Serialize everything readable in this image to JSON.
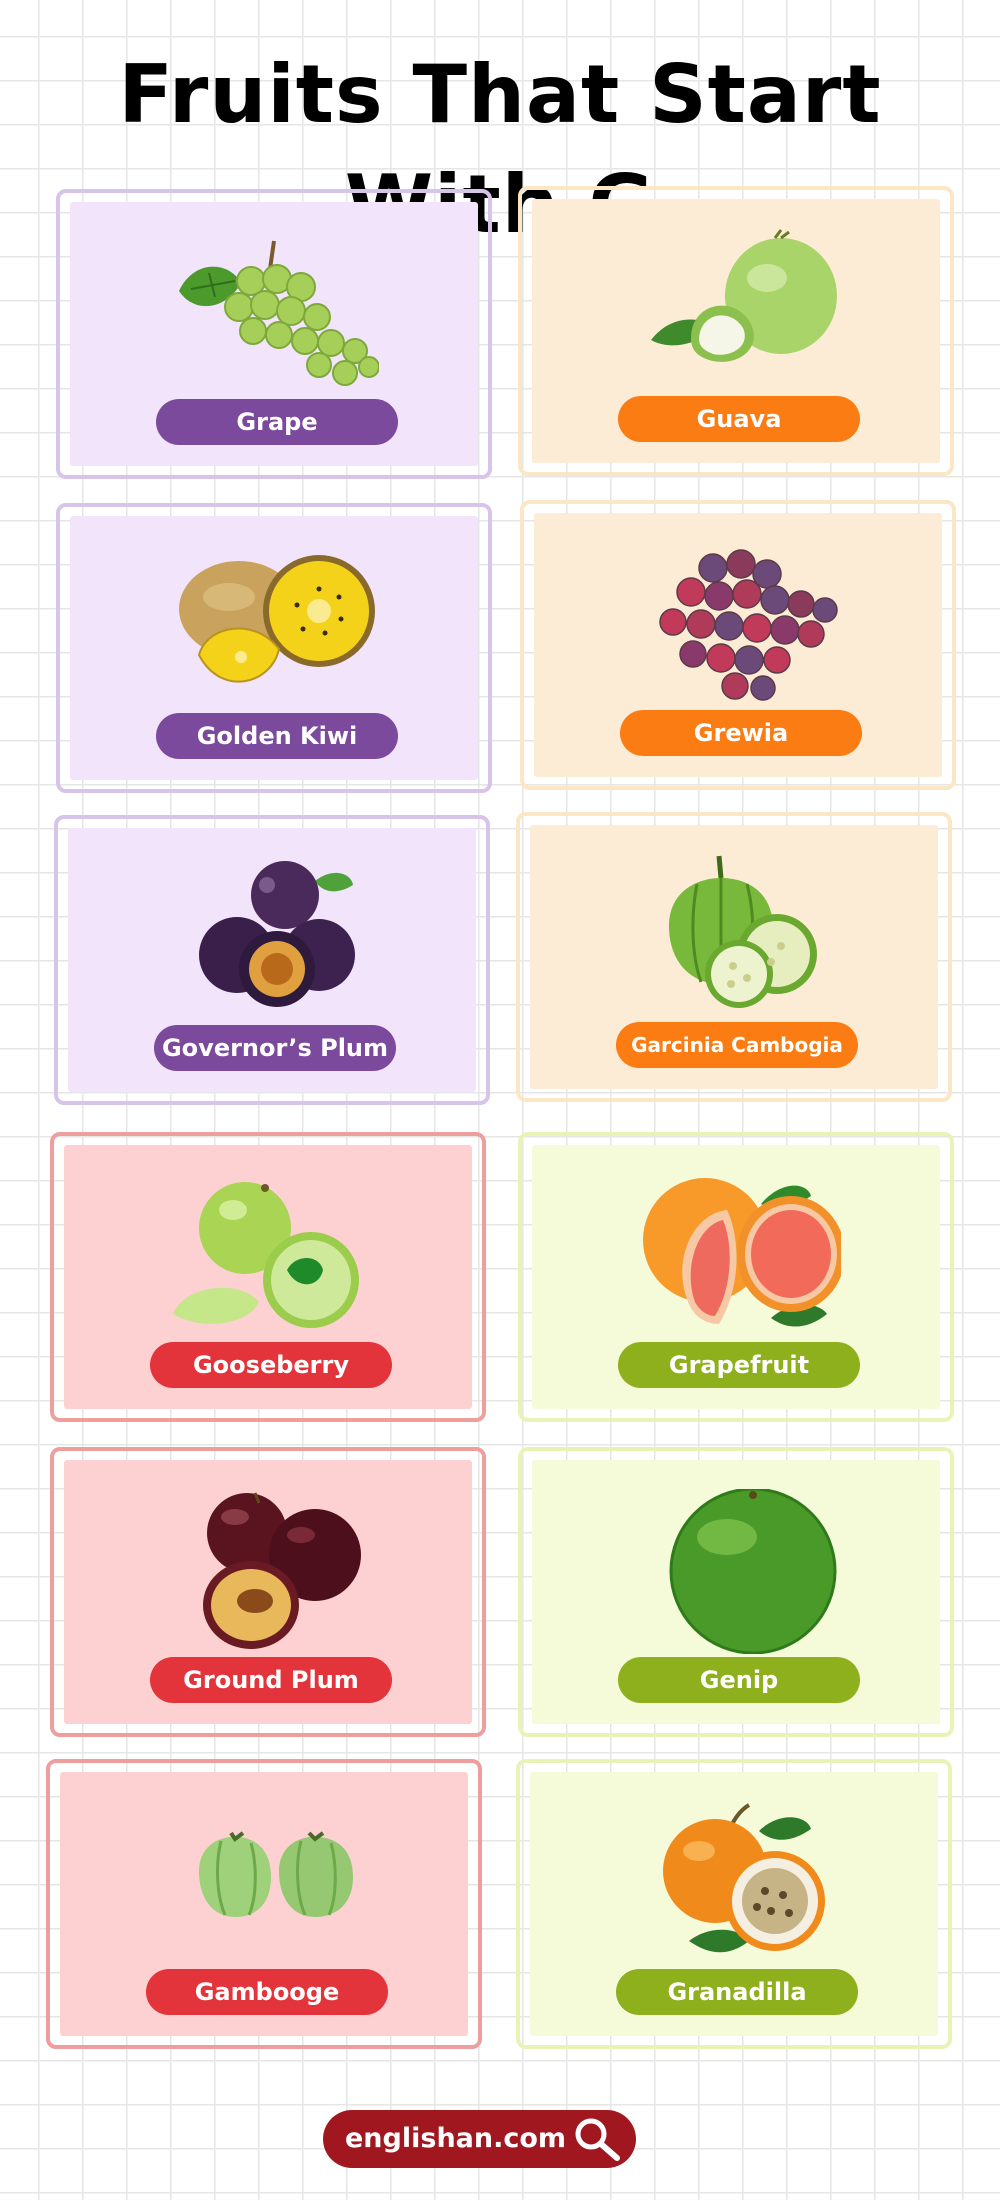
{
  "title": "Fruits That Start With G",
  "cards": [
    {
      "name": "Grape",
      "icon": "grape-icon",
      "theme": "purple"
    },
    {
      "name": "Guava",
      "icon": "guava-icon",
      "theme": "peach"
    },
    {
      "name": "Golden Kiwi",
      "icon": "golden-kiwi-icon",
      "theme": "purple"
    },
    {
      "name": "Grewia",
      "icon": "grewia-icon",
      "theme": "peach"
    },
    {
      "name": "Governor’s Plum",
      "icon": "governors-plum-icon",
      "theme": "purple"
    },
    {
      "name": "Garcinia Cambogia",
      "icon": "garcinia-cambogia-icon",
      "theme": "peach"
    },
    {
      "name": "Gooseberry",
      "icon": "gooseberry-icon",
      "theme": "pink"
    },
    {
      "name": "Grapefruit",
      "icon": "grapefruit-icon",
      "theme": "lime"
    },
    {
      "name": "Ground Plum",
      "icon": "ground-plum-icon",
      "theme": "pink"
    },
    {
      "name": "Genip",
      "icon": "genip-icon",
      "theme": "lime"
    },
    {
      "name": "Gambooge",
      "icon": "gambooge-icon",
      "theme": "pink"
    },
    {
      "name": "Granadilla",
      "icon": "granadilla-icon",
      "theme": "lime"
    }
  ],
  "footer": {
    "site": "englishan.com",
    "icon": "search-icon"
  },
  "colors": {
    "purple_label": "#7b4a9c",
    "peach_label": "#fb7c13",
    "pink_label": "#e2343a",
    "lime_label": "#8fb01d",
    "footer_badge": "#a11720"
  }
}
